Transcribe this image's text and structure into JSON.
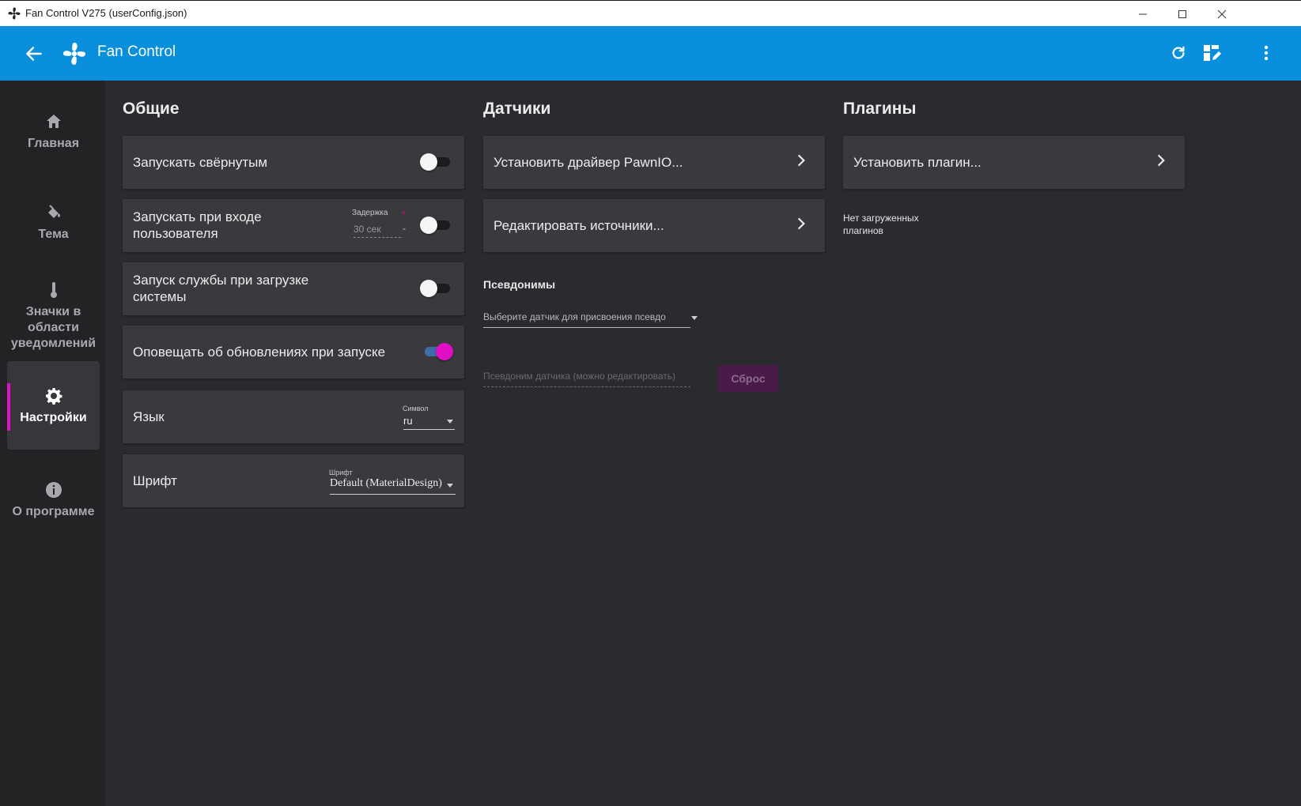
{
  "window": {
    "title": "Fan Control V275 (userConfig.json)"
  },
  "appbar": {
    "title": "Fan Control",
    "accent_color": "#0a8fdc"
  },
  "sidebar": {
    "items": [
      {
        "label": "Главная",
        "icon": "home-icon"
      },
      {
        "label": "Тема",
        "icon": "paint-bucket-icon"
      },
      {
        "label": "Значки в области уведомлений",
        "icon": "thermometer-icon"
      },
      {
        "label": "Настройки",
        "icon": "gear-icon",
        "active": true
      },
      {
        "label": "О программе",
        "icon": "info-icon"
      }
    ]
  },
  "general": {
    "title": "Общие",
    "start_minimized": {
      "label": "Запускать свёрнутым",
      "on": false
    },
    "start_on_login": {
      "label": "Запускать при входе пользователя",
      "on": false,
      "delay_label": "Задержка",
      "delay_value": "30 сек",
      "plus": "+",
      "minus": "-"
    },
    "service_on_boot": {
      "label": "Запуск службы при загрузке системы",
      "on": false
    },
    "notify_updates": {
      "label": "Оповещать об обновлениях при запуске",
      "on": true
    },
    "language": {
      "label": "Язык",
      "field_label": "Символ",
      "value": "ru"
    },
    "font": {
      "label": "Шрифт",
      "field_label": "Шрифт",
      "value": "Default (MaterialDesign)"
    }
  },
  "sensors": {
    "title": "Датчики",
    "install_driver": "Установить драйвер PawnIO...",
    "edit_sources": "Редактировать источники...",
    "aliases_title": "Псевдонимы",
    "select_placeholder": "Выберите датчик для присвоения псевдо",
    "alias_placeholder": "Псевдоним датчика (можно редактировать)",
    "reset_label": "Сброс"
  },
  "plugins": {
    "title": "Плагины",
    "install_plugin": "Установить плагин...",
    "no_plugins": "Нет загруженных плагинов"
  },
  "colors": {
    "accent_pink": "#e10fc3",
    "toggle_on_track": "#3e6ea8"
  }
}
